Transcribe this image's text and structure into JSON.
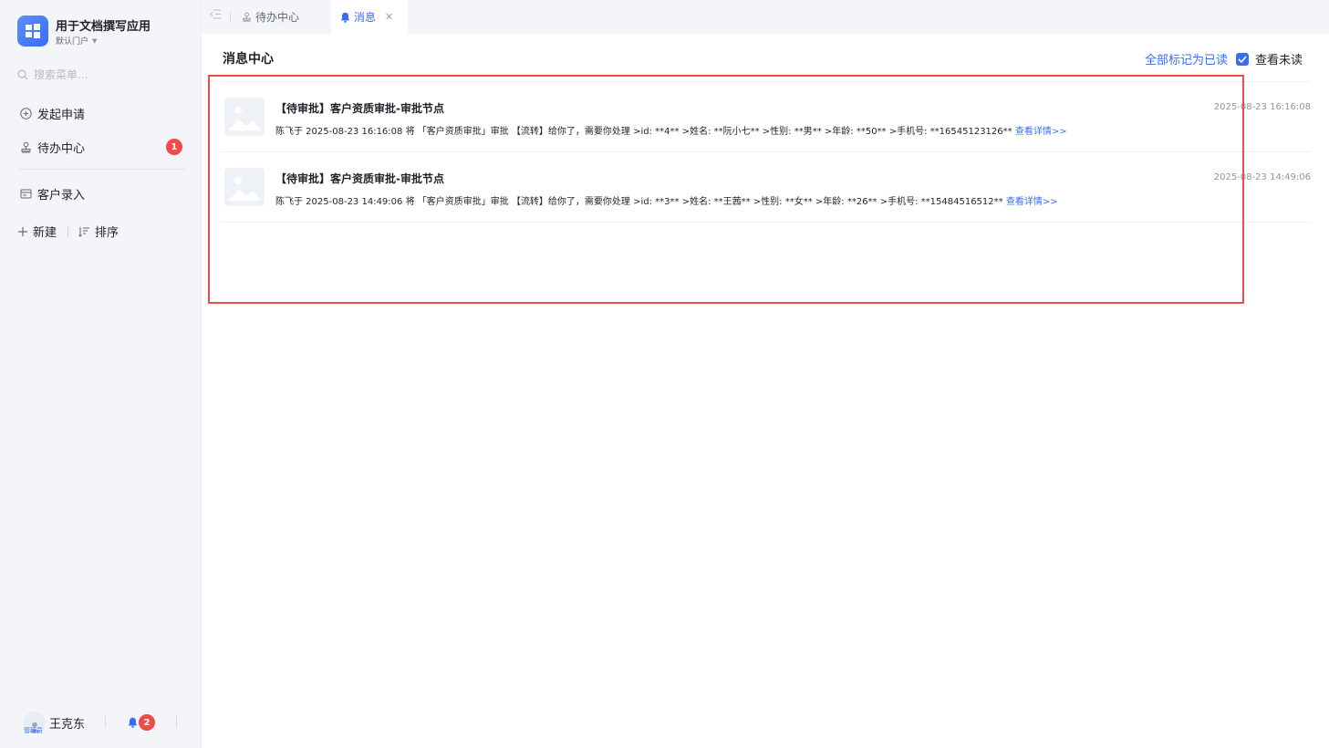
{
  "sidebar": {
    "app_title": "用于文档撰写应用",
    "portal": "默认门户",
    "search_placeholder": "搜索菜单...",
    "items": [
      {
        "label": "发起申请",
        "icon": "plus-circle-icon"
      },
      {
        "label": "待办中心",
        "icon": "stamp-icon",
        "badge": "1"
      },
      {
        "label": "客户录入",
        "icon": "form-icon"
      }
    ],
    "new_label": "新建",
    "sort_label": "排序",
    "user_name": "王克东",
    "user_role": "管理员",
    "notification_count": "2"
  },
  "tabs": [
    {
      "label": "待办中心",
      "icon": "stamp-icon"
    },
    {
      "label": "消息",
      "icon": "bell-icon",
      "active": true
    }
  ],
  "main": {
    "title": "消息中心",
    "mark_all_read": "全部标记为已读",
    "view_unread": "查看未读",
    "view_unread_checked": true,
    "messages": [
      {
        "title": "【待审批】客户资质审批-审批节点",
        "time": "2025-08-23 16:16:08",
        "body": "陈飞于 2025-08-23 16:16:08 将 「客户资质审批」审批 【流转】给你了，需要你处理 >id: **4** >姓名: **阮小七** >性别: **男** >年龄: **50** >手机号: **16545123126** ",
        "link": "查看详情>>"
      },
      {
        "title": "【待审批】客户资质审批-审批节点",
        "time": "2025-08-23 14:49:06",
        "body": "陈飞于 2025-08-23 14:49:06 将 「客户资质审批」审批 【流转】给你了，需要你处理 >id: **3** >姓名: **王茜** >性别: **女** >年龄: **26** >手机号: **15484516512** ",
        "link": "查看详情>>"
      }
    ]
  },
  "colors": {
    "accent": "#3b6cf6",
    "badge": "#f04a4a",
    "highlight_border": "#e8504f"
  }
}
